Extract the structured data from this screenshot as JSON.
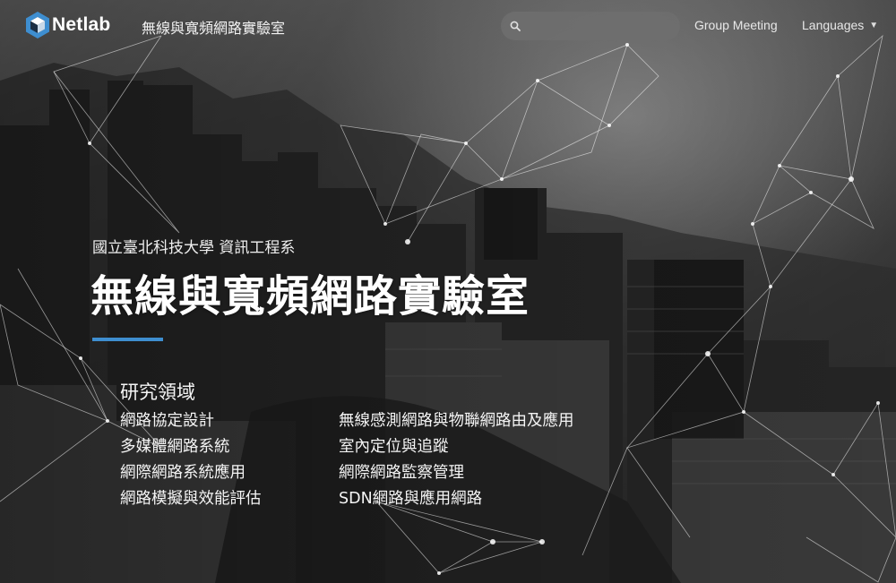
{
  "brand": {
    "name": "Netlab",
    "subtitle": "無線與寬頻網路實驗室"
  },
  "search": {
    "placeholder": "",
    "value": ""
  },
  "nav": {
    "group_meeting": "Group Meeting",
    "languages": "Languages"
  },
  "hero": {
    "department": "國立臺北科技大學 資訊工程系",
    "title": "無線與寬頻網路實驗室",
    "accent_color": "#3e8ed0"
  },
  "research": {
    "heading": "研究領域",
    "left": [
      "網路協定設計",
      "多媒體網路系統",
      "網際網路系統應用",
      "網路模擬與效能評估"
    ],
    "right": [
      "無線感測網路與物聯網路由及應用",
      "室內定位與追蹤",
      "網際網路監察管理",
      "SDN網路與應用網路"
    ]
  },
  "icons": {
    "logo": "hexagon-cube-icon",
    "search": "search-icon",
    "dropdown": "caret-down-icon"
  }
}
